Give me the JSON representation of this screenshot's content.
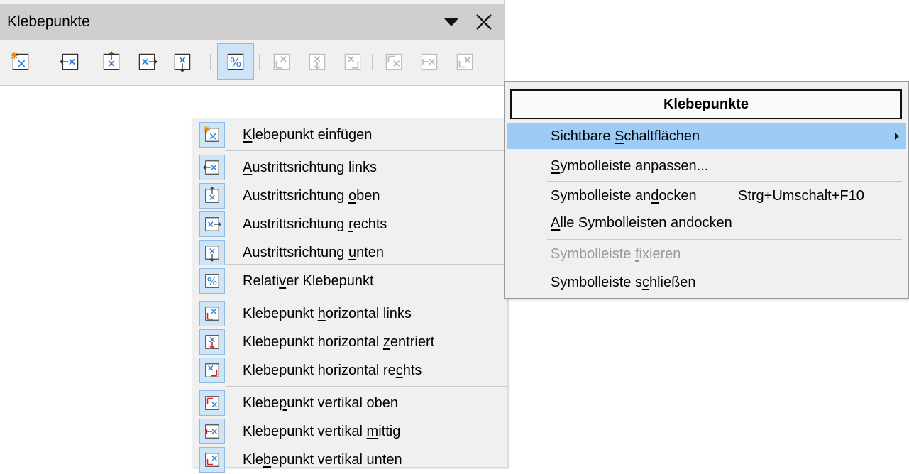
{
  "toolbar": {
    "title": "Klebepunkte",
    "menu_icon": "triangle-down-icon",
    "close_icon": "close-x-icon",
    "buttons": [
      {
        "icon": "insert-gluepoint-icon",
        "state": "enabled"
      },
      {
        "icon": "exit-direction-left-icon",
        "state": "enabled"
      },
      {
        "icon": "exit-direction-top-icon",
        "state": "enabled"
      },
      {
        "icon": "exit-direction-right-icon",
        "state": "enabled"
      },
      {
        "icon": "exit-direction-bottom-icon",
        "state": "enabled"
      },
      {
        "icon": "relative-gluepoint-icon",
        "state": "active"
      },
      {
        "icon": "gluepoint-horizontal-left-icon",
        "state": "disabled"
      },
      {
        "icon": "gluepoint-horizontal-center-icon",
        "state": "disabled"
      },
      {
        "icon": "gluepoint-horizontal-right-icon",
        "state": "disabled"
      },
      {
        "icon": "gluepoint-vertical-top-icon",
        "state": "disabled"
      },
      {
        "icon": "gluepoint-vertical-center-icon",
        "state": "disabled"
      },
      {
        "icon": "gluepoint-vertical-bottom-icon",
        "state": "disabled"
      }
    ]
  },
  "button_menu": {
    "items": [
      {
        "pre": "",
        "u": "K",
        "post": "lebepunkt einfügen",
        "icon": "insert-gluepoint-icon"
      },
      {
        "pre": "",
        "u": "A",
        "post": "ustrittsrichtung links",
        "icon": "exit-direction-left-icon"
      },
      {
        "pre": "Austrittsrichtung ",
        "u": "o",
        "post": "ben",
        "icon": "exit-direction-top-icon"
      },
      {
        "pre": "Austrittsrichtung ",
        "u": "r",
        "post": "echts",
        "icon": "exit-direction-right-icon"
      },
      {
        "pre": "Austrittsrichtung ",
        "u": "u",
        "post": "nten",
        "icon": "exit-direction-bottom-icon"
      },
      {
        "pre": "Relati",
        "u": "v",
        "post": "er Klebepunkt",
        "icon": "relative-gluepoint-icon"
      },
      {
        "pre": "Klebepunkt ",
        "u": "h",
        "post": "orizontal links",
        "icon": "gluepoint-horizontal-left-icon"
      },
      {
        "pre": "Klebepunkt horizontal ",
        "u": "z",
        "post": "entriert",
        "icon": "gluepoint-horizontal-center-icon"
      },
      {
        "pre": "Klebepunkt horizontal re",
        "u": "c",
        "post": "hts",
        "icon": "gluepoint-horizontal-right-icon"
      },
      {
        "pre": "Klebe",
        "u": "p",
        "post": "unkt vertikal oben",
        "icon": "gluepoint-vertical-top-icon"
      },
      {
        "pre": "Klebepunkt vertikal ",
        "u": "m",
        "post": "ittig",
        "icon": "gluepoint-vertical-center-icon"
      },
      {
        "pre": "Kle",
        "u": "b",
        "post": "epunkt vertikal unten",
        "icon": "gluepoint-vertical-bottom-icon"
      }
    ]
  },
  "context_menu": {
    "header": "Klebepunkte",
    "items": [
      {
        "pre": "Sichtbare ",
        "u": "S",
        "post": "chaltflächen",
        "shortcut": "",
        "state": "highlighted",
        "submenu": true
      },
      {
        "pre": "",
        "u": "S",
        "post": "ymbolleiste anpassen...",
        "shortcut": "",
        "state": "enabled",
        "submenu": false
      },
      {
        "pre": "Symbolleiste an",
        "u": "d",
        "post": "ocken",
        "shortcut": "Strg+Umschalt+F10",
        "state": "enabled",
        "submenu": false
      },
      {
        "pre": "",
        "u": "A",
        "post": "lle Symbolleisten andocken",
        "shortcut": "",
        "state": "enabled",
        "submenu": false
      },
      {
        "pre": "Symbolleiste ",
        "u": "f",
        "post": "ixieren",
        "shortcut": "",
        "state": "disabled",
        "submenu": false
      },
      {
        "pre": "Symbolleiste s",
        "u": "c",
        "post": "hließen",
        "shortcut": "",
        "state": "enabled",
        "submenu": false
      }
    ]
  },
  "colors": {
    "toolbar_bg": "#f0f0f0",
    "titlebar_bg": "#cfcfcf",
    "active_button_bg": "#cfe4f7",
    "active_button_border": "#8dbbe3",
    "highlight_bg": "#9ccbf5",
    "disabled_text": "#9a9a9a",
    "icon_accent": "#2a7fd4",
    "icon_red": "#d42020"
  }
}
